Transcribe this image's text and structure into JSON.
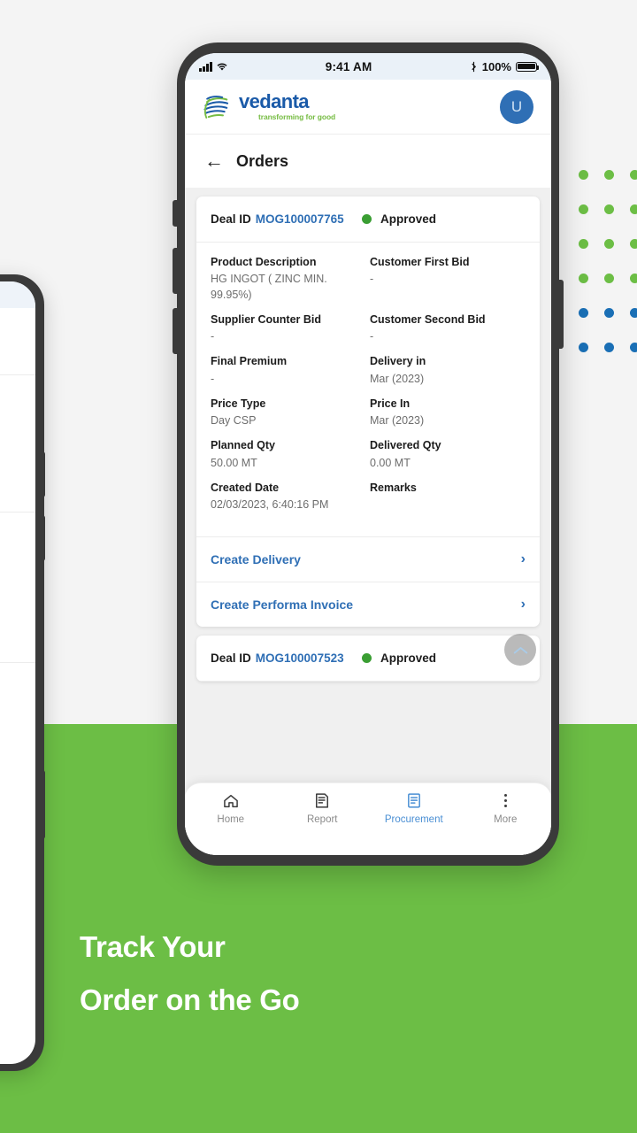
{
  "colors": {
    "green_bg": "#6cbe45",
    "brand_blue": "#1a5aa8",
    "brand_green": "#76bc43",
    "link_blue": "#2f6fb5",
    "status_green": "#3a9e33",
    "dot_green": "#6cbe45",
    "dot_blue": "#1a6fb5"
  },
  "status_bar": {
    "time": "9:41 AM",
    "battery_percent": "100%",
    "signal_icon": "cellular-bars-icon",
    "wifi_icon": "wifi-icon",
    "bluetooth_icon": "bluetooth-icon",
    "battery_icon": "battery-full-icon"
  },
  "app_header": {
    "logo_icon": "vedanta-globe-logo-icon",
    "brand_name": "vedanta",
    "tagline": "transforming for good",
    "avatar_initial": "U"
  },
  "title_bar": {
    "back_icon": "back-arrow-icon",
    "title": "Orders"
  },
  "fab": {
    "icon": "chevron-up-icon",
    "glyph": "⌃"
  },
  "orders": [
    {
      "deal_label": "Deal ID",
      "deal_id": "MOG100007765",
      "status": "Approved",
      "fields": [
        [
          {
            "label": "Product Description",
            "value": "HG INGOT ( ZINC MIN. 99.95%)"
          },
          {
            "label": "Customer First Bid",
            "value": "-"
          }
        ],
        [
          {
            "label": "Supplier Counter Bid",
            "value": "-"
          },
          {
            "label": "Customer Second Bid",
            "value": "-"
          }
        ],
        [
          {
            "label": "Final Premium",
            "value": "-"
          },
          {
            "label": "Delivery in",
            "value": "Mar (2023)"
          }
        ],
        [
          {
            "label": "Price Type",
            "value": "Day CSP"
          },
          {
            "label": "Price In",
            "value": "Mar (2023)"
          }
        ],
        [
          {
            "label": "Planned Qty",
            "value": "50.00 MT"
          },
          {
            "label": "Delivered Qty",
            "value": "0.00 MT"
          }
        ],
        [
          {
            "label": "Created Date",
            "value": "02/03/2023, 6:40:16 PM"
          },
          {
            "label": "Remarks",
            "value": ""
          }
        ]
      ],
      "actions": [
        {
          "label": "Create Delivery",
          "chevron": "›"
        },
        {
          "label": "Create Performa Invoice",
          "chevron": "›"
        }
      ]
    },
    {
      "deal_label": "Deal ID",
      "deal_id": "MOG100007523",
      "status": "Approved"
    }
  ],
  "bottom_nav": [
    {
      "label": "Home",
      "icon": "home-icon",
      "active": false
    },
    {
      "label": "Report",
      "icon": "report-document-icon",
      "active": false
    },
    {
      "label": "Procurement",
      "icon": "procurement-document-icon",
      "active": true
    },
    {
      "label": "More",
      "icon": "more-vertical-dots-icon",
      "active": false
    }
  ],
  "promo": {
    "line1": "Track Your",
    "line2": "Order on the Go"
  }
}
